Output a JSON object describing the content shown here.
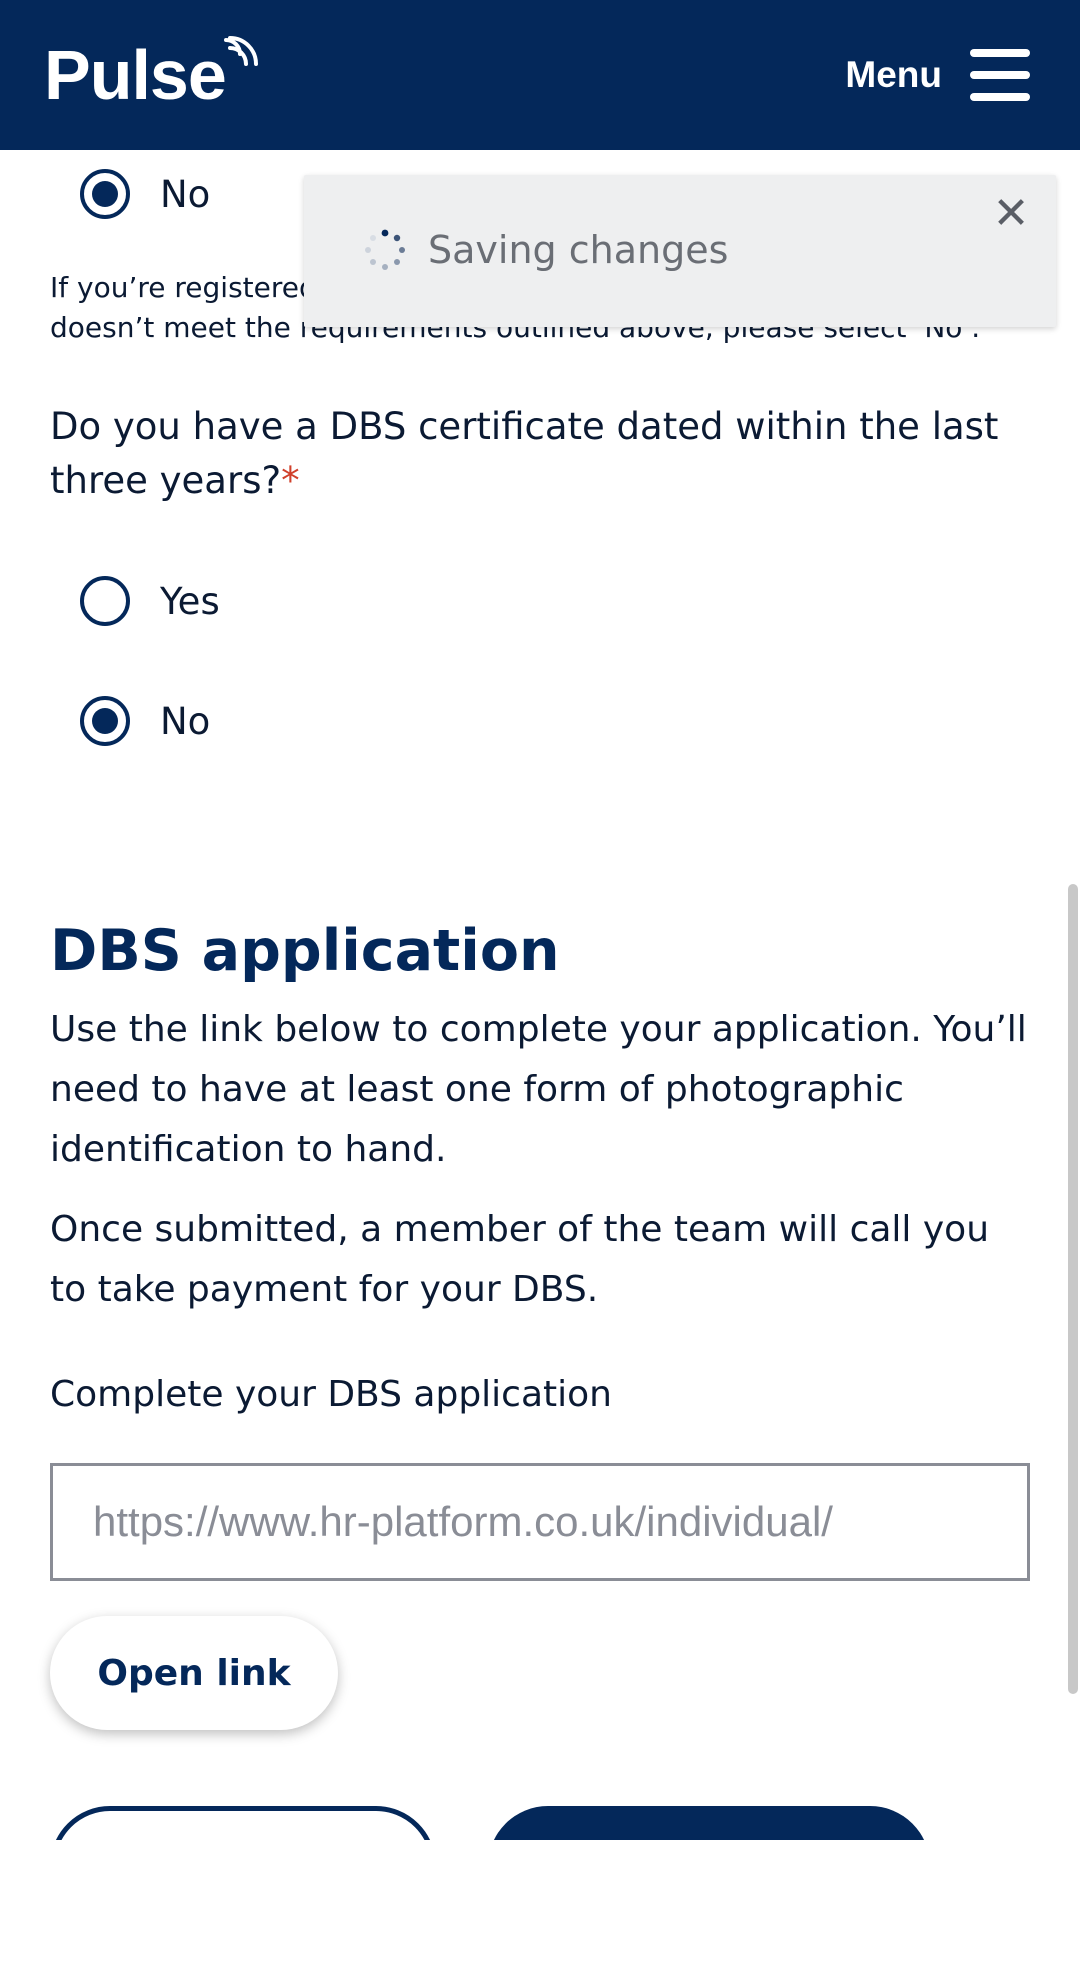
{
  "header": {
    "logo_text": "Pulse",
    "menu_label": "Menu"
  },
  "previous_question": {
    "selected_option_label": "No",
    "hint_text": "If you’re registered with the DBS Update Service but your certificate doesn’t meet the requirements outlined above, please select ‘No’."
  },
  "dbs_question": {
    "text": "Do you have a DBS certificate dated within the last three years?",
    "required_marker": "*",
    "options": [
      {
        "label": "Yes",
        "selected": false
      },
      {
        "label": "No",
        "selected": true
      }
    ]
  },
  "dbs_application": {
    "title": "DBS application",
    "paragraph_1": "Use the link below to complete your application. You’ll need to have at least one form of photographic identification to hand.",
    "paragraph_2": "Once submitted, a member of the team will call you to take payment for your DBS.",
    "link_label": "Complete your DBS application",
    "link_value": "https://www.hr-platform.co.uk/individual/",
    "open_link_label": "Open link"
  },
  "toast": {
    "message": "Saving changes",
    "close_icon": "close-icon",
    "spinner_icon": "spinner-icon"
  },
  "colors": {
    "brand_navy": "#04285a",
    "required_red": "#d0402b",
    "toast_bg": "#eeeff0"
  }
}
